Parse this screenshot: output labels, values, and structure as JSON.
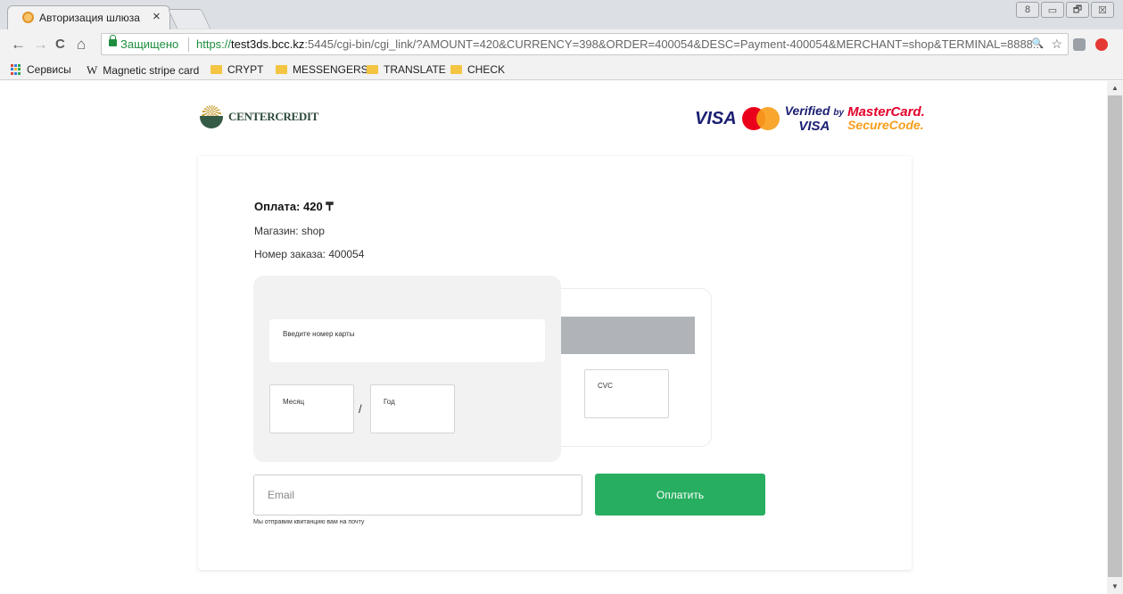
{
  "browser": {
    "tab_title": "Авторизация шлюза",
    "tab_close": "×",
    "window_controls": [
      "8",
      "▭",
      "🗗",
      "☒"
    ],
    "nav": {
      "back": "←",
      "forward": "→",
      "reload": "C",
      "home": "⌂"
    },
    "address": {
      "secure_label": "Защищено",
      "url_scheme": "https://",
      "url_host": "test3ds.bcc.kz",
      "url_rest": ":5445/cgi-bin/cgi_link/?AMOUNT=420&CURRENCY=398&ORDER=400054&DESC=Payment-400054&MERCHANT=shop&TERMINAL=8888..."
    },
    "omni_icons": {
      "zoom": "🔍",
      "star": "☆"
    },
    "bookmarks": {
      "services": "Сервисы",
      "magnetic_icon": "W",
      "magnetic": "Magnetic stripe card",
      "crypt": "CRYPT",
      "messengers": "MESSENGERS",
      "translate": "TRANSLATE",
      "check": "CHECK"
    }
  },
  "page": {
    "logo_text": "CENTERCREDIT",
    "brands": {
      "visa": "VISA",
      "vbv_line1": "Verified",
      "vbv_by": "by",
      "vbv_line2": "VISA",
      "mc_line1": "MasterCard.",
      "mc_line2": "SecureCode."
    },
    "payment": {
      "amount_label": "Оплата:",
      "amount_value": "420 ₸",
      "merchant_line": "Магазин: shop",
      "order_line": "Номер заказа: 400054"
    },
    "card": {
      "number_label": "Введите номер карты",
      "month_label": "Месяц",
      "slash": "/",
      "year_label": "Год",
      "cvc_label": "CVC"
    },
    "email": {
      "placeholder": "Email",
      "hint": "Мы отправим квитанцию вам на почту"
    },
    "pay_button": "Оплатить"
  },
  "colors": {
    "pay_green": "#27ae60",
    "secure_green": "#1e8e3e",
    "visa_blue": "#1a1f71",
    "mc_red": "#eb001b",
    "mc_orange": "#f79e1b"
  }
}
